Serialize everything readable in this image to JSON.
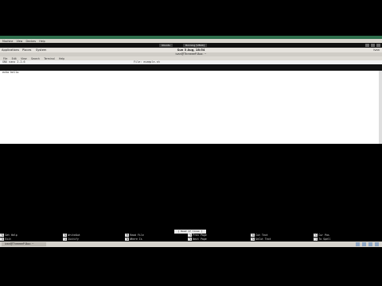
{
  "host": {
    "title_text": "Ubuntu Desktop",
    "menu": [
      "Machine",
      "View",
      "Devices",
      "Help"
    ]
  },
  "vm_titlebar": {
    "tabs": [
      "Ubuntu",
      "Running [VBOX]"
    ]
  },
  "panel": {
    "applications": "Applications",
    "places": "Places",
    "system": "System",
    "clock": "Sun 3 Aug, 18:54",
    "user": "Ivan"
  },
  "terminal": {
    "title": "ivan@ThreeeeP-Box: ~",
    "menu": [
      "File",
      "Edit",
      "View",
      "Search",
      "Terminal",
      "Help"
    ]
  },
  "nano": {
    "version": "GNU nano 2.2.6",
    "file": "File: example.sh",
    "lines": [
      "echo hello"
    ],
    "status": "[ Read 17 lines ]"
  },
  "shortcuts": [
    {
      "k1": "^G",
      "l1": "Get Help",
      "k2": "^X",
      "l2": "Exit"
    },
    {
      "k1": "^O",
      "l1": "WriteOut",
      "k2": "^J",
      "l2": "Justify"
    },
    {
      "k1": "^R",
      "l1": "Read File",
      "k2": "^W",
      "l2": "Where Is"
    },
    {
      "k1": "^Y",
      "l1": "Prev Page",
      "k2": "^V",
      "l2": "Next Page"
    },
    {
      "k1": "^K",
      "l1": "Cut Text",
      "k2": "^U",
      "l2": "UnCut Text"
    },
    {
      "k1": "^C",
      "l1": "Cur Pos",
      "k2": "^T",
      "l2": "To Spell"
    }
  ],
  "taskbar": {
    "task": "ivan@ThreeeeP-Box: ~"
  }
}
